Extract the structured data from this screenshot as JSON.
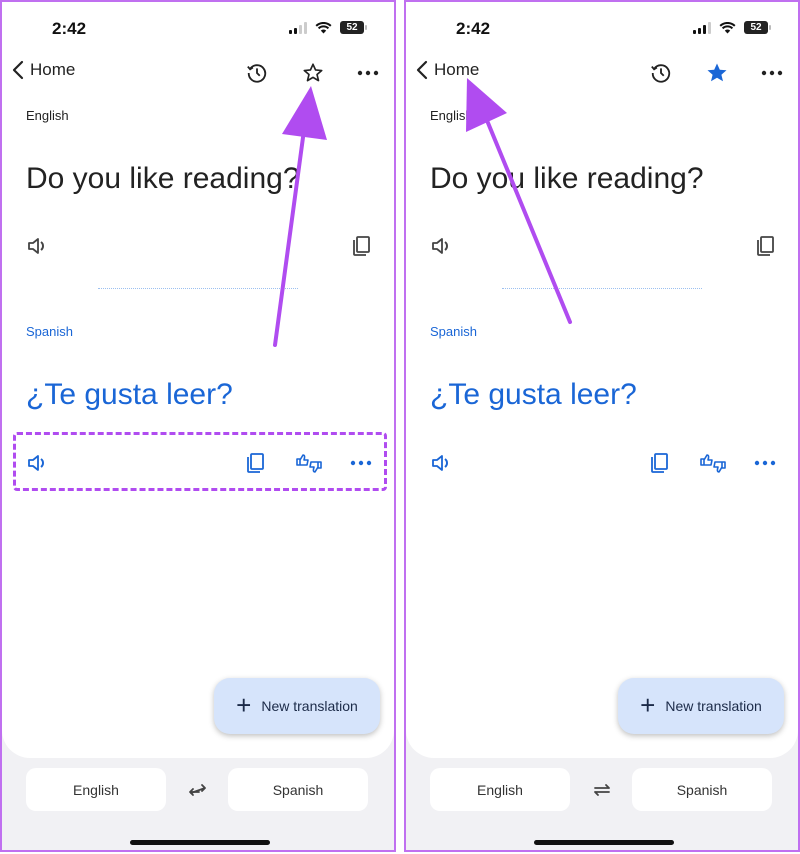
{
  "panels": [
    {
      "status": {
        "time": "2:42",
        "battery": "52"
      },
      "nav": {
        "back_label": "Home",
        "favorite_state": "unstarred"
      },
      "source": {
        "language": "English",
        "text": "Do you like reading?"
      },
      "target": {
        "language": "Spanish",
        "text": "¿Te gusta leer?"
      },
      "fab_label": "New translation",
      "bottom": {
        "source_lang": "English",
        "target_lang": "Spanish"
      },
      "annotation": "arrow pointing to star button; dashed box around translation actions"
    },
    {
      "status": {
        "time": "2:42",
        "battery": "52"
      },
      "nav": {
        "back_label": "Home",
        "favorite_state": "starred"
      },
      "source": {
        "language": "English",
        "text": "Do you like reading?"
      },
      "target": {
        "language": "Spanish",
        "text": "¿Te gusta leer?"
      },
      "fab_label": "New translation",
      "bottom": {
        "source_lang": "English",
        "target_lang": "Spanish"
      },
      "annotation": "arrow pointing to Home back button"
    }
  ],
  "colors": {
    "accent": "#1a66d6",
    "annotation": "#b04cf0",
    "fab_bg": "#d6e4fb",
    "star_filled": "#1a66d6"
  }
}
